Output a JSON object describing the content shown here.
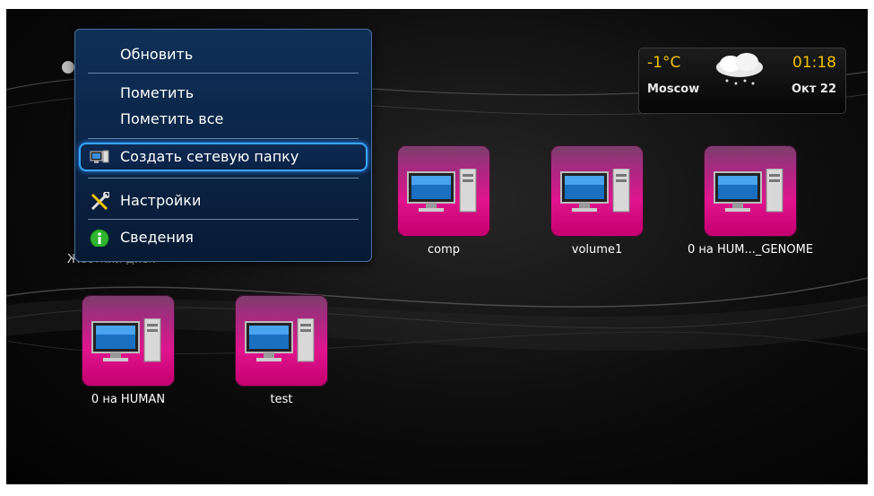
{
  "menu": {
    "items": [
      {
        "label": "Обновить",
        "icon": "none"
      },
      {
        "label": "Пометить",
        "icon": "none"
      },
      {
        "label": "Пометить все",
        "icon": "none"
      },
      {
        "label": "Создать сетевую папку",
        "icon": "network-folder-icon",
        "selected": true
      },
      {
        "label": "Настройки",
        "icon": "tools-icon"
      },
      {
        "label": "Сведения",
        "icon": "info-icon"
      }
    ]
  },
  "weather": {
    "temperature": "-1°C",
    "city": "Moscow",
    "time": "01:18",
    "date": "Окт 22",
    "icon": "snow-cloud-icon"
  },
  "tiles": [
    {
      "label": "comp"
    },
    {
      "label": "volume1"
    },
    {
      "label": "0 на HUM..._GENOME"
    },
    {
      "label": "0 на HUMAN"
    },
    {
      "label": "test"
    }
  ],
  "partial_tile": {
    "label": "Жесткий диск"
  },
  "colors": {
    "tile_pink": "#e0148e",
    "menu_bg": "#0b2547",
    "highlight": "#3aa6ff",
    "weather_text": "#f2c200"
  }
}
